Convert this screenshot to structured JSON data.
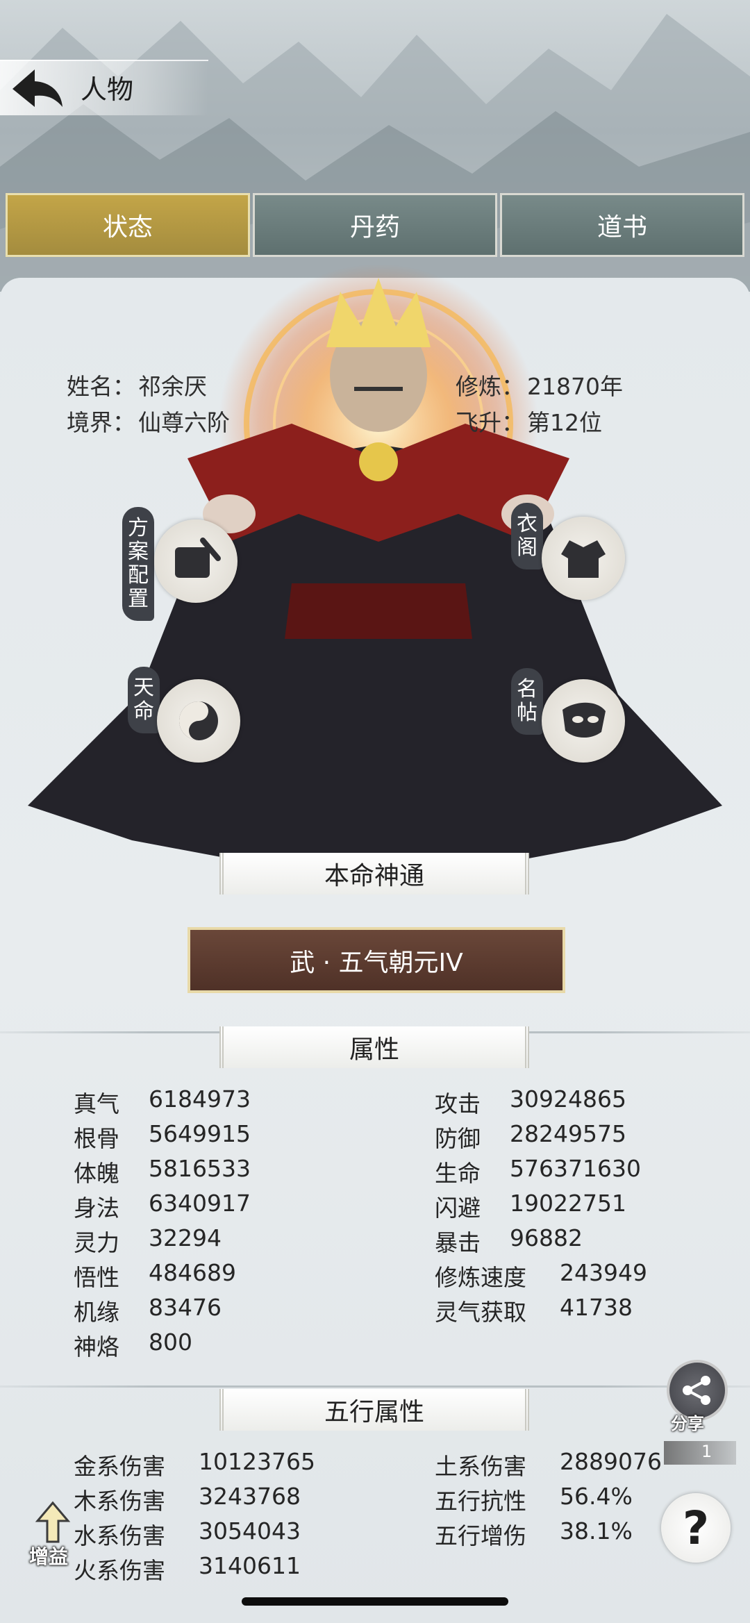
{
  "header": {
    "title": "人物"
  },
  "tabs": [
    {
      "label": "状态",
      "active": true
    },
    {
      "label": "丹药",
      "active": false
    },
    {
      "label": "道书",
      "active": false
    }
  ],
  "character": {
    "name_label": "姓名：",
    "name": "祁余厌",
    "realm_label": "境界：",
    "realm": "仙尊六阶",
    "cultivation_label": "修炼：",
    "cultivation": "21870年",
    "ascension_label": "飞升：",
    "ascension": "第12位"
  },
  "side_buttons": {
    "plan_config": "方案配置",
    "destiny": "天命",
    "wardrobe": "衣阁",
    "name_card": "名帖"
  },
  "skill": {
    "section_title": "本命神通",
    "name": "武 · 五气朝元IV"
  },
  "attributes": {
    "section_title": "属性",
    "left": [
      {
        "label": "真气",
        "value": "6184973"
      },
      {
        "label": "根骨",
        "value": "5649915"
      },
      {
        "label": "体魄",
        "value": "5816533"
      },
      {
        "label": "身法",
        "value": "6340917"
      },
      {
        "label": "灵力",
        "value": "32294"
      },
      {
        "label": "悟性",
        "value": "484689"
      },
      {
        "label": "机缘",
        "value": "83476"
      },
      {
        "label": "神烙",
        "value": "800"
      }
    ],
    "right": [
      {
        "label": "攻击",
        "value": "30924865"
      },
      {
        "label": "防御",
        "value": "28249575"
      },
      {
        "label": "生命",
        "value": "576371630"
      },
      {
        "label": "闪避",
        "value": "19022751"
      },
      {
        "label": "暴击",
        "value": "96882"
      },
      {
        "label": "修炼速度",
        "value": "243949"
      },
      {
        "label": "灵气获取",
        "value": "41738"
      }
    ]
  },
  "elements": {
    "section_title": "五行属性",
    "left": [
      {
        "label": "金系伤害",
        "value": "10123765"
      },
      {
        "label": "木系伤害",
        "value": "3243768"
      },
      {
        "label": "水系伤害",
        "value": "3054043"
      },
      {
        "label": "火系伤害",
        "value": "3140611"
      }
    ],
    "right": [
      {
        "label": "土系伤害",
        "value": "2889076"
      },
      {
        "label": "五行抗性",
        "value": "56.4%"
      },
      {
        "label": "五行增伤",
        "value": "38.1%"
      }
    ]
  },
  "floating": {
    "share_label": "分享",
    "share_count": "1",
    "help_symbol": "?",
    "buff_label": "增益"
  },
  "colors": {
    "active_tab": "#b89c45",
    "inactive_tab": "#6b7d7c",
    "skill_button": "#5e3c30"
  }
}
